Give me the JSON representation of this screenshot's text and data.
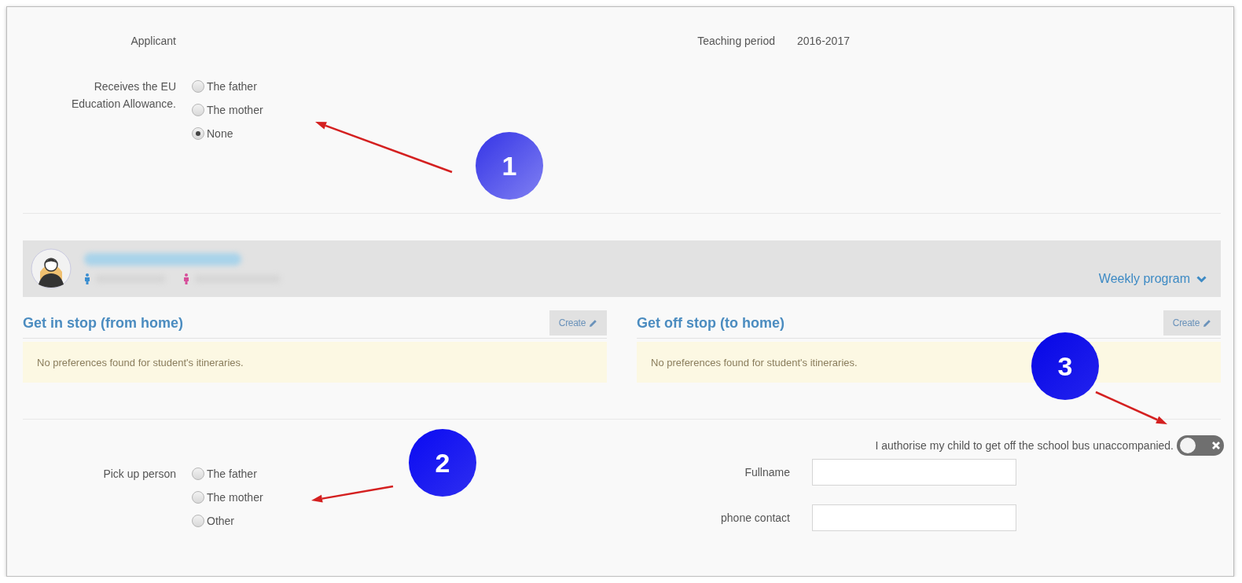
{
  "applicant": {
    "label": "Applicant"
  },
  "teaching_period": {
    "label": "Teaching period",
    "value": "2016-2017"
  },
  "allowance": {
    "label": "Receives the EU Education Allowance.",
    "options": [
      {
        "label": "The father",
        "selected": false
      },
      {
        "label": "The mother",
        "selected": false
      },
      {
        "label": "None",
        "selected": true
      }
    ]
  },
  "student": {
    "weekly_program": "Weekly program"
  },
  "stops": [
    {
      "title": "Get in stop (from home)",
      "button": "Create",
      "message": "No preferences found for student's itineraries."
    },
    {
      "title": "Get off stop (to home)",
      "button": "Create",
      "message": "No preferences found for student's itineraries."
    }
  ],
  "pickup": {
    "label": "Pick up person",
    "options": [
      {
        "label": "The father",
        "selected": false
      },
      {
        "label": "The mother",
        "selected": false
      },
      {
        "label": "Other",
        "selected": false
      }
    ]
  },
  "authorisation": {
    "label": "I authorise my child to get off the school bus unaccompanied.",
    "on": false
  },
  "fields": [
    {
      "label": "Fullname"
    },
    {
      "label": "phone contact"
    }
  ],
  "annotations": [
    {
      "number": "1"
    },
    {
      "number": "2"
    },
    {
      "number": "3"
    }
  ]
}
